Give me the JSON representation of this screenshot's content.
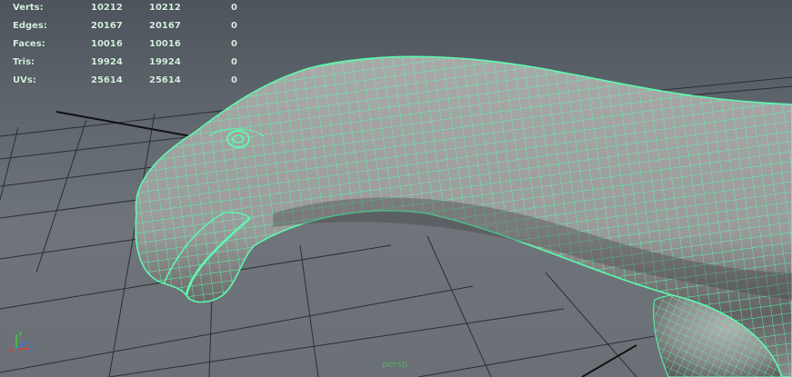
{
  "hud": {
    "rows": [
      {
        "label": "Verts:",
        "v1": "10212",
        "v2": "10212",
        "v3": "0"
      },
      {
        "label": "Edges:",
        "v1": "20167",
        "v2": "20167",
        "v3": "0"
      },
      {
        "label": "Faces:",
        "v1": "10016",
        "v2": "10016",
        "v3": "0"
      },
      {
        "label": "Tris:",
        "v1": "19924",
        "v2": "19924",
        "v3": "0"
      },
      {
        "label": "UVs:",
        "v1": "25614",
        "v2": "25614",
        "v3": "0"
      }
    ]
  },
  "camera": {
    "label": "persp"
  },
  "axis": {
    "x": "x",
    "y": "y",
    "z": "z"
  },
  "colors": {
    "wireframe": "#5dfbb0",
    "grid": "#2a2f34",
    "axis_x": "#e23b3b",
    "axis_y": "#3bd13b",
    "axis_z": "#3b6fe2",
    "hud_text": "#d9f0e3"
  }
}
